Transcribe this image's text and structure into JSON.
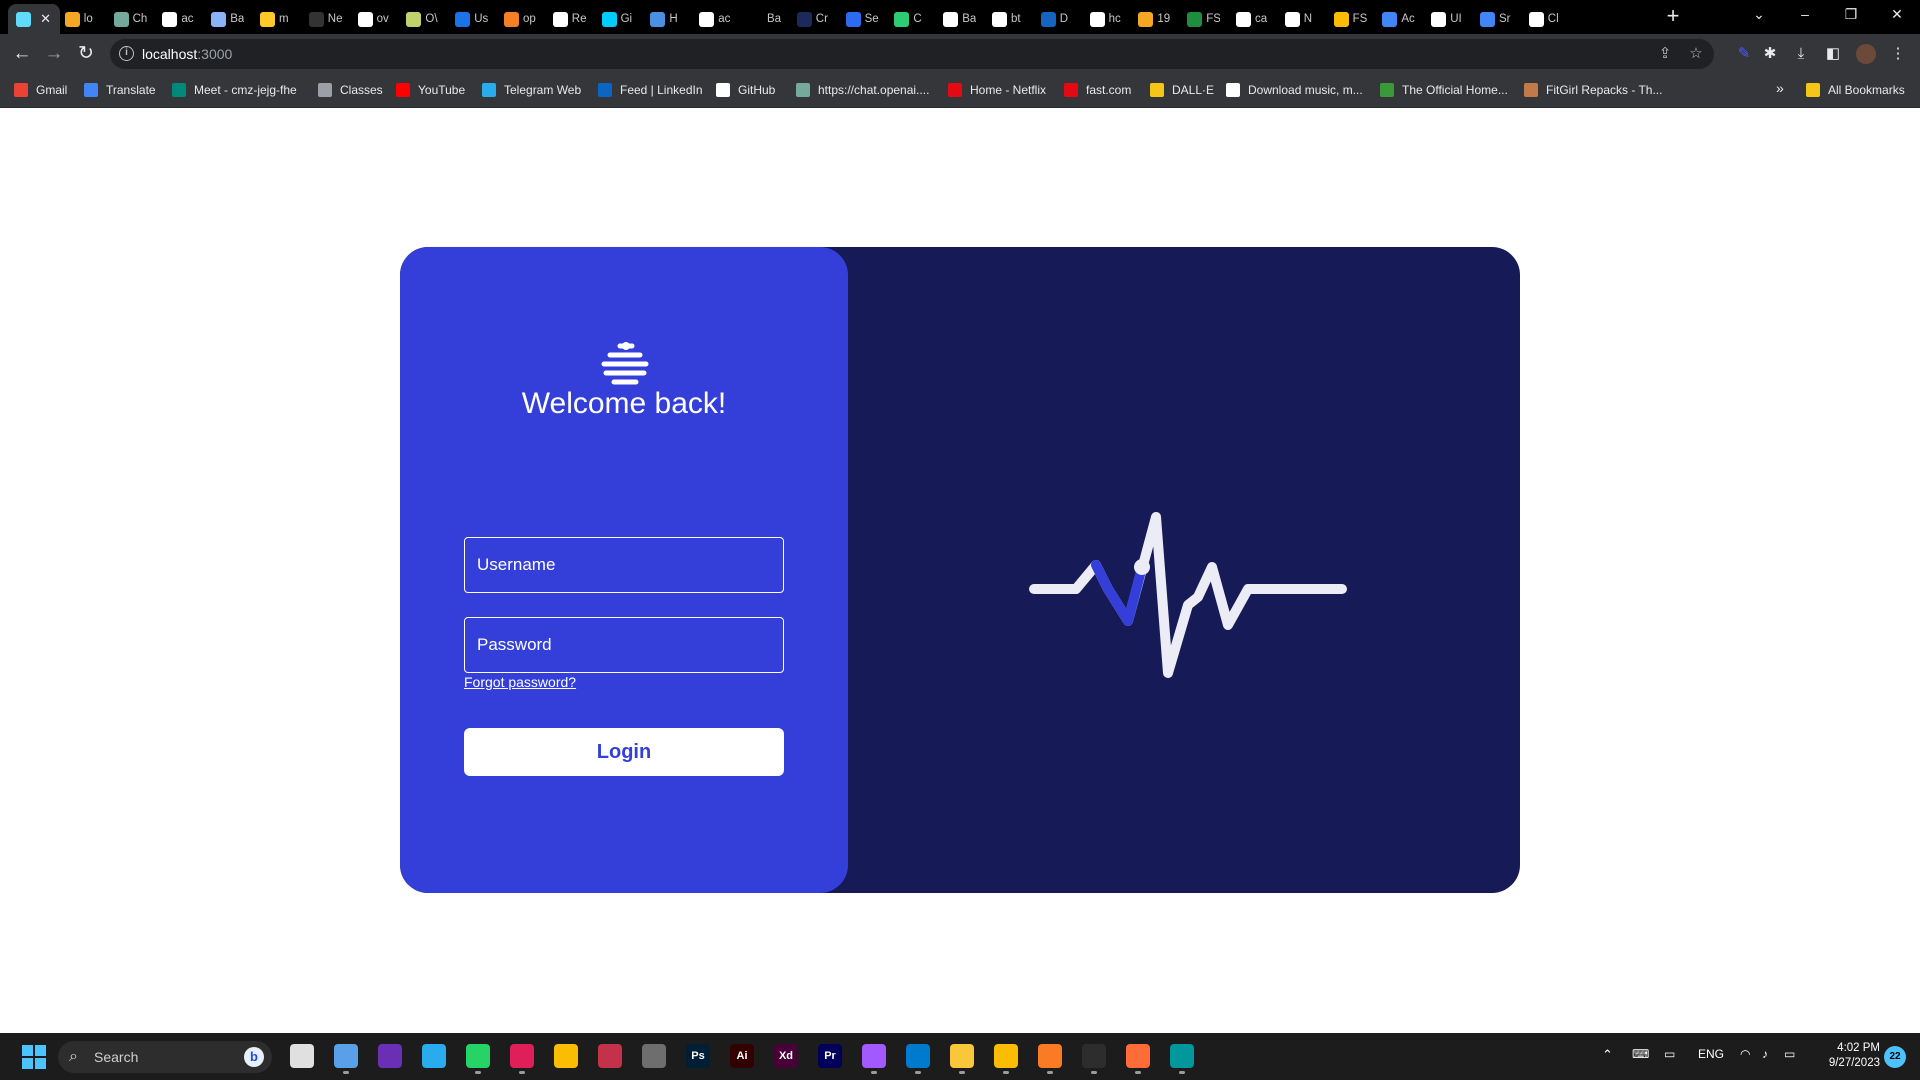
{
  "browser": {
    "tabs": [
      {
        "title": "",
        "icon": "react-icon",
        "color": "#61dafb",
        "active": true
      },
      {
        "title": "lo",
        "icon": "vercel-icon",
        "color": "#f5a623"
      },
      {
        "title": "Ch",
        "icon": "chatgpt-icon",
        "color": "#74aa9c"
      },
      {
        "title": "ac",
        "icon": "github-icon",
        "color": "#ffffff"
      },
      {
        "title": "Ba",
        "icon": "bard-icon",
        "color": "#8ab4f8"
      },
      {
        "title": "m",
        "icon": "firebase-icon",
        "color": "#ffca28"
      },
      {
        "title": "Ne",
        "icon": "nextjs-icon",
        "color": "#333333"
      },
      {
        "title": "ov",
        "icon": "google-icon",
        "color": "#ffffff"
      },
      {
        "title": "O\\",
        "icon": "openai-icon",
        "color": "#c0d36a"
      },
      {
        "title": "Us",
        "icon": "lock-icon",
        "color": "#1a73e8"
      },
      {
        "title": "op",
        "icon": "stackoverflow-icon",
        "color": "#f48024"
      },
      {
        "title": "Re",
        "icon": "github-icon",
        "color": "#ffffff"
      },
      {
        "title": "Gi",
        "icon": "giphy-icon",
        "color": "#00ccff"
      },
      {
        "title": "H",
        "icon": "hash-icon",
        "color": "#4a90e2"
      },
      {
        "title": "ac",
        "icon": "github-icon",
        "color": "#ffffff"
      },
      {
        "title": "Ba",
        "icon": "blank-icon",
        "color": "#000000"
      },
      {
        "title": "Cr",
        "icon": "crunchyroll-icon",
        "color": "#1b2a5a"
      },
      {
        "title": "Se",
        "icon": "signal-icon",
        "color": "#2c6bed"
      },
      {
        "title": "C",
        "icon": "w-icon",
        "color": "#2ecc71"
      },
      {
        "title": "Ba",
        "icon": "image-icon",
        "color": "#ffffff"
      },
      {
        "title": "bt",
        "icon": "google-icon",
        "color": "#ffffff"
      },
      {
        "title": "D",
        "icon": "two-icon",
        "color": "#1565c0"
      },
      {
        "title": "hc",
        "icon": "google-icon",
        "color": "#ffffff"
      },
      {
        "title": "19",
        "icon": "vercel-icon",
        "color": "#f5a623"
      },
      {
        "title": "FS",
        "icon": "sheets-icon",
        "color": "#1e8e3e"
      },
      {
        "title": "ca",
        "icon": "google-icon",
        "color": "#ffffff"
      },
      {
        "title": "N",
        "icon": "github-icon",
        "color": "#ffffff"
      },
      {
        "title": "FS",
        "icon": "drive-icon",
        "color": "#fbbc04"
      },
      {
        "title": "Ac",
        "icon": "docs-icon",
        "color": "#4285f4"
      },
      {
        "title": "UI",
        "icon": "image-icon",
        "color": "#ffffff"
      },
      {
        "title": "Sr",
        "icon": "docs-icon",
        "color": "#4285f4"
      },
      {
        "title": "Cl",
        "icon": "github-icon",
        "color": "#ffffff"
      }
    ],
    "url_host": "localhost",
    "url_port": ":3000",
    "bookmarks": [
      {
        "label": "Gmail",
        "icon": "gmail-icon",
        "color": "#ea4335"
      },
      {
        "label": "Translate",
        "icon": "translate-icon",
        "color": "#4285f4"
      },
      {
        "label": "Meet - cmz-jejg-fhe",
        "icon": "meet-icon",
        "color": "#00897b"
      },
      {
        "label": "Classes",
        "icon": "classes-icon",
        "color": "#9aa0a6"
      },
      {
        "label": "YouTube",
        "icon": "youtube-icon",
        "color": "#ff0000"
      },
      {
        "label": "Telegram Web",
        "icon": "telegram-icon",
        "color": "#2aabee"
      },
      {
        "label": "Feed | LinkedIn",
        "icon": "linkedin-icon",
        "color": "#0a66c2"
      },
      {
        "label": "GitHub",
        "icon": "github-icon",
        "color": "#ffffff"
      },
      {
        "label": "https://chat.openai....",
        "icon": "chatgpt-icon",
        "color": "#74aa9c"
      },
      {
        "label": "Home - Netflix",
        "icon": "netflix-icon",
        "color": "#e50914"
      },
      {
        "label": "fast.com",
        "icon": "fast-icon",
        "color": "#e50914"
      },
      {
        "label": "DALL·E",
        "icon": "dalle-icon",
        "color": "#f5c518"
      },
      {
        "label": "Download music, m...",
        "icon": "download-music-icon",
        "color": "#ffffff"
      },
      {
        "label": "The Official Home...",
        "icon": "official-home-icon",
        "color": "#3a9a3a"
      },
      {
        "label": "FitGirl Repacks - Th...",
        "icon": "fitgirl-icon",
        "color": "#c17a4a"
      }
    ],
    "all_bookmarks": "All Bookmarks"
  },
  "login": {
    "welcome": "Welcome back!",
    "username_placeholder": "Username",
    "password_placeholder": "Password",
    "forgot": "Forgot password?",
    "button": "Login",
    "colors": {
      "left_panel": "#333fd8",
      "right_panel": "#161a57",
      "pulse_line": "#ececf6",
      "pulse_accent": "#333fd8"
    }
  },
  "taskbar": {
    "search": "Search",
    "apps": [
      {
        "icon": "task-view-icon",
        "color": "#e0e0e0",
        "text": ""
      },
      {
        "icon": "notepad-icon",
        "color": "#5aa0e8",
        "text": ""
      },
      {
        "icon": "obs-icon",
        "color": "#6b2fb5",
        "text": ""
      },
      {
        "icon": "telegram-icon",
        "color": "#2aabee",
        "text": ""
      },
      {
        "icon": "whatsapp-icon",
        "color": "#25d366",
        "text": ""
      },
      {
        "icon": "slack-icon",
        "color": "#e01e5a",
        "text": ""
      },
      {
        "icon": "chrome-icon",
        "color": "#fbbc04",
        "text": ""
      },
      {
        "icon": "snipping-tool-icon",
        "color": "#c4314b",
        "text": ""
      },
      {
        "icon": "calculator-icon",
        "color": "#6e6e6e",
        "text": ""
      },
      {
        "icon": "photoshop-icon",
        "color": "#001e36",
        "text": "Ps"
      },
      {
        "icon": "illustrator-icon",
        "color": "#330000",
        "text": "Ai"
      },
      {
        "icon": "xd-icon",
        "color": "#470137",
        "text": "Xd"
      },
      {
        "icon": "premiere-icon",
        "color": "#00005b",
        "text": "Pr"
      },
      {
        "icon": "figma-icon",
        "color": "#a259ff",
        "text": ""
      },
      {
        "icon": "vscode-icon",
        "color": "#007acc",
        "text": ""
      },
      {
        "icon": "file-explorer-icon",
        "color": "#f8c73a",
        "text": ""
      },
      {
        "icon": "chrome-icon",
        "color": "#fbbc04",
        "text": ""
      },
      {
        "icon": "xampp-icon",
        "color": "#fb7a24",
        "text": ""
      },
      {
        "icon": "terminal-icon",
        "color": "#2d2d2d",
        "text": ""
      },
      {
        "icon": "postman-icon",
        "color": "#ff6c37",
        "text": ""
      },
      {
        "icon": "arduino-icon",
        "color": "#00979d",
        "text": ""
      }
    ],
    "lang": "ENG",
    "time": "4:02 PM",
    "date": "9/27/2023",
    "notifications": "22"
  }
}
